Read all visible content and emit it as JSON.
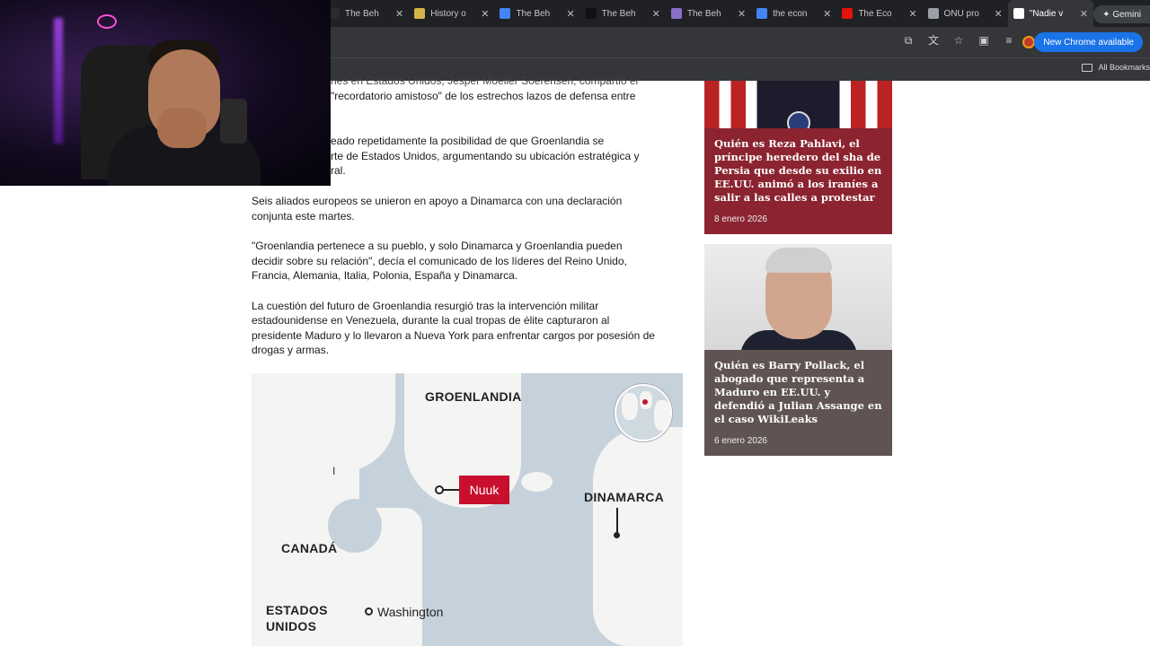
{
  "browser": {
    "tabs": [
      {
        "title": "The Beh",
        "favicon_color": "#2b2b2b"
      },
      {
        "title": "History o",
        "favicon_color": "#d4b44a"
      },
      {
        "title": "The Beh",
        "favicon_color": "#4285f4"
      },
      {
        "title": "The Beh",
        "favicon_color": "#111111"
      },
      {
        "title": "The Beh",
        "favicon_color": "#8a6fc9"
      },
      {
        "title": "the econ",
        "favicon_color": "#4285f4"
      },
      {
        "title": "The Eco",
        "favicon_color": "#e3120b"
      },
      {
        "title": "ONU pro",
        "favicon_color": "#9aa0a6"
      },
      {
        "title": "\"Nadie v",
        "favicon_color": "#ffffff",
        "active": true
      }
    ],
    "new_tab": "+",
    "gemini_label": "✦ Gemini",
    "update_button": "New Chrome available",
    "bookmarks_label": "All Bookmarks"
  },
  "article": {
    "line1": "nes en Estados Unidos, Jesper Moeller Soerensen, compartió el",
    "line2": "\"recordatorio amistoso\" de los estrechos lazos de defensa entre",
    "line3": "eado repetidamente la posibilidad de que Groenlandia se",
    "line4": "rte de Estados Unidos, argumentando su ubicación estratégica y",
    "line5": "ral.",
    "p1": "Seis aliados europeos se unieron en apoyo a Dinamarca con una declaración conjunta este martes.",
    "p2": "\"Groenlandia pertenece a su pueblo, y solo Dinamarca y Groenlandia pueden decidir sobre su relación\", decía el comunicado de los líderes del Reino Unido, Francia, Alemania, Italia, Polonia, España y Dinamarca.",
    "p3": "La cuestión del futuro de Groenlandia resurgió tras la intervención militar estadounidense en Venezuela, durante la cual tropas de élite capturaron al presidente Maduro y lo llevaron a Nueva York para enfrentar cargos por posesión de drogas y armas."
  },
  "map": {
    "greenland": "GROENLANDIA",
    "nuuk": "Nuuk",
    "denmark": "DINAMARCA",
    "canada": "CANADÁ",
    "usa": "ESTADOS\nUNIDOS",
    "washington": "Washington",
    "nuuk_color": "#c8102e",
    "water_color": "#c6d2db"
  },
  "sidebar": {
    "cards": [
      {
        "headline": "Quién es Reza Pahlavi, el príncipe heredero del sha de Persia que desde su exilio en EE.UU. animó a los iraníes a salir a las calles a protestar",
        "date": "8 enero 2026"
      },
      {
        "headline": "Quién es Barry Pollack, el abogado que representa a Maduro en EE.UU. y defendió a Julian Assange en el caso WikiLeaks",
        "date": "6 enero 2026"
      }
    ]
  }
}
